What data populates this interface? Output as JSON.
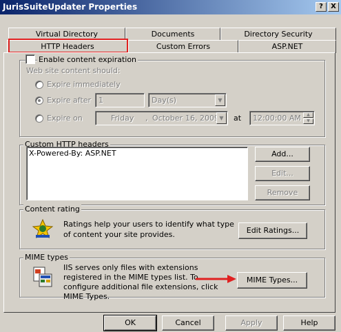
{
  "window": {
    "title": "JurisSuiteUpdater Properties",
    "help_btn": "?",
    "close_btn": "X"
  },
  "tabs_row1": [
    "Virtual Directory",
    "Documents",
    "Directory Security"
  ],
  "tabs_row2": [
    "HTTP Headers",
    "Custom Errors",
    "ASP.NET"
  ],
  "expiration": {
    "checkbox_label": "Enable content expiration",
    "subtitle": "Web site content should:",
    "immediately": "Expire immediately",
    "after": "Expire after",
    "after_value": "1",
    "after_unit": "Day(s)",
    "on": "Expire on",
    "on_date_day": "Friday",
    "on_date_month": "October",
    "on_date_num": "16, 2009",
    "at": "at",
    "time": "12:00:00 AM"
  },
  "custom_headers": {
    "legend": "Custom HTTP headers",
    "items": [
      "X-Powered-By: ASP.NET"
    ],
    "add": "Add...",
    "edit": "Edit...",
    "remove": "Remove"
  },
  "rating": {
    "legend": "Content rating",
    "text": "Ratings help your users to identify what type of content your site provides.",
    "button": "Edit Ratings..."
  },
  "mime": {
    "legend": "MIME types",
    "text": "IIS serves only files with extensions registered in the MIME types list. To configure additional file extensions, click MIME Types.",
    "button": "MIME Types..."
  },
  "footer": {
    "ok": "OK",
    "cancel": "Cancel",
    "apply": "Apply",
    "help": "Help"
  },
  "colors": {
    "titlebar_start": "#0a246a",
    "titlebar_end": "#a6caf0",
    "highlight": "#e02020",
    "arrow": "#e02020"
  }
}
